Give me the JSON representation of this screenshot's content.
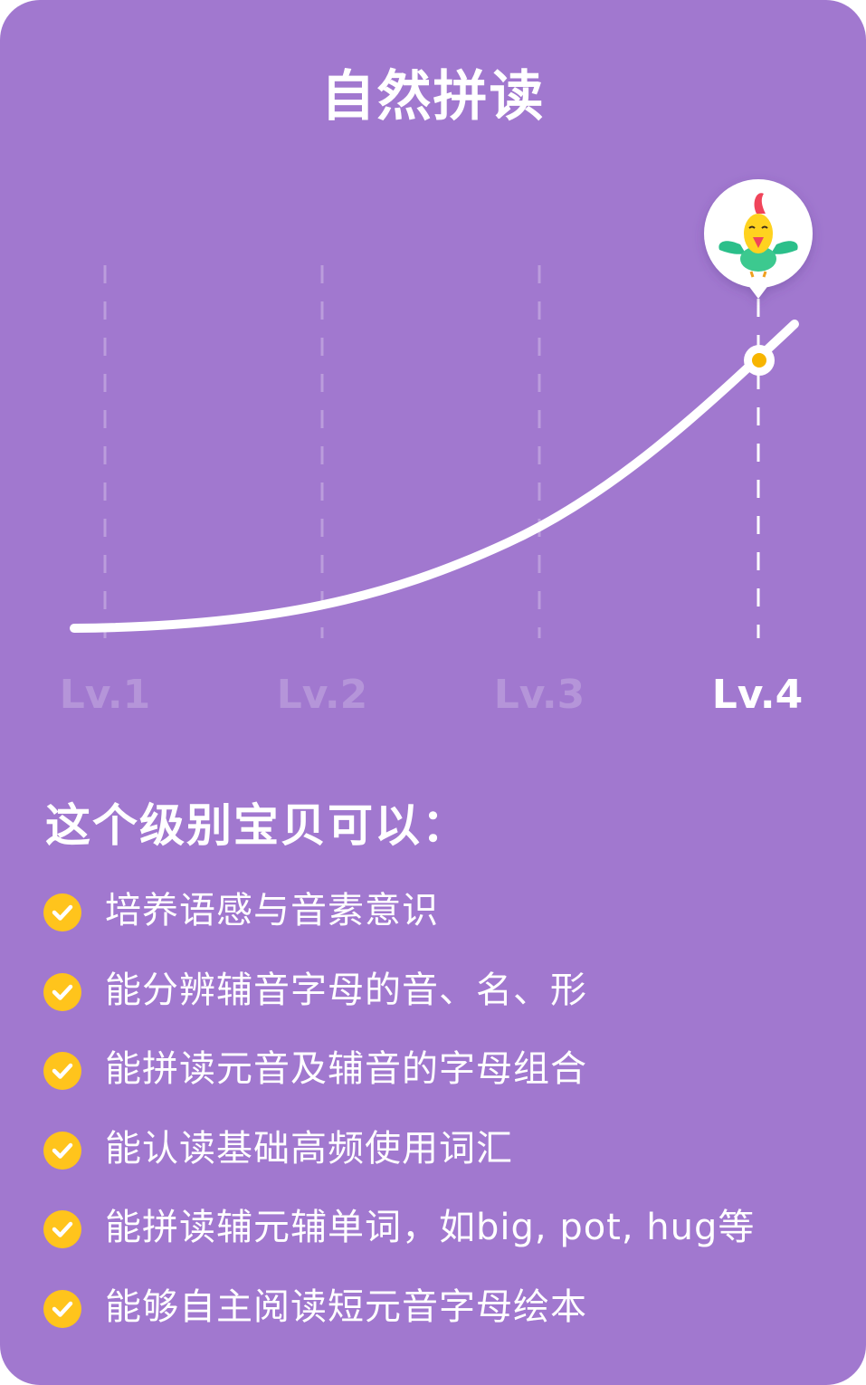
{
  "title": "自然拼读",
  "chart_data": {
    "type": "line",
    "categories": [
      "Lv.1",
      "Lv.2",
      "Lv.3",
      "Lv.4"
    ],
    "current_level": "Lv.4",
    "marker_icon": "parrot-mascot-icon",
    "colors": {
      "background": "#a178cf",
      "curve": "#ffffff",
      "marker_dot": "#f7b500",
      "guide_line": "rgba(255,255,255,0.3)"
    }
  },
  "section": {
    "heading": "这个级别宝贝可以：",
    "check_icon": "check-circle-icon",
    "check_color": "#ffc41c",
    "items": [
      "培养语感与音素意识",
      "能分辨辅音字母的音、名、形",
      "能拼读元音及辅音的字母组合",
      "能认读基础高频使用词汇",
      "能拼读辅元辅单词，如big, pot, hug等",
      "能够自主阅读短元音字母绘本"
    ]
  }
}
